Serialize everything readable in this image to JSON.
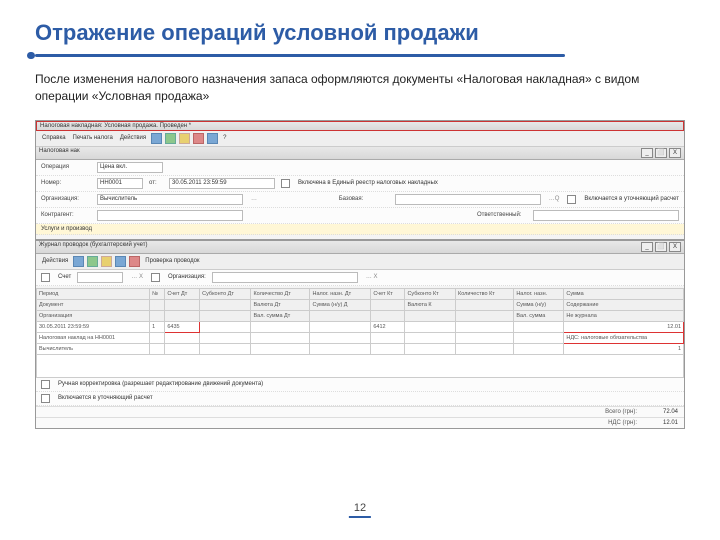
{
  "title": "Отражение операций условной продажи",
  "desc": "После изменения налогового назначения запаса оформляются документы «Налоговая накладная» с видом операции «Условная продажа»",
  "win1": {
    "title": "Налоговая накладная: Условная продажа. Проведен *",
    "btns": [
      "_",
      "⬜",
      "X"
    ]
  },
  "menu": [
    "Справка",
    "Печать налога",
    "Действия",
    "?"
  ],
  "row_op": {
    "lbl": "Операция",
    "val": "Ценa вкл."
  },
  "row_num": {
    "lbl": "Номер:",
    "val": "НН0001",
    "date_lbl": "от:",
    "date": "30.05.2011   23:59:59",
    "right1": "Включена в Единый реестр налоговых накладных",
    "right2": "Включается в уточняющий расчет"
  },
  "row_org": {
    "lbl": "Организация:",
    "val": "Вычислитель",
    "r_lbl": "Базовая:",
    "r_val": ""
  },
  "row_contr": {
    "lbl": "Контрагент:",
    "val": "",
    "r_lbl": "Ответственный:",
    "r_val": ""
  },
  "yellow": "Услуги и производ",
  "win2": {
    "title": "Журнал проводок (бухгалтерский учет)",
    "btns": [
      "_",
      "⬜",
      "X"
    ]
  },
  "tb2": [
    "Действия",
    "Проверка проводок"
  ],
  "filter": {
    "chk1": "Счет",
    "chk2": "Организация:"
  },
  "grid": {
    "h": [
      "Период",
      "№",
      "Счет Дт",
      "Субконто Дт",
      "Количество Дт",
      "Налог. назн. Дт",
      "Счет Кт",
      "Субконто Кт",
      "Количество Кт",
      "Налог. назн.",
      "Сумма"
    ],
    "h2": [
      "Документ",
      "",
      "",
      "",
      "Валюта Дт",
      "Сумма (н/у) Д",
      "",
      "Валюта К",
      "",
      "Сумма (н/у)",
      "Содержание"
    ],
    "h3": [
      "Организация",
      "",
      "",
      "",
      "Вал. сумма Дт",
      "",
      "",
      "",
      "",
      "Вал. сумма",
      "Не журнала"
    ],
    "r1": [
      "30.05.2011 23:59:59",
      "1",
      "6435",
      "",
      "",
      "",
      "6412",
      "",
      "",
      "",
      "12.01"
    ],
    "r2": [
      "Налоговая наклад на НН0001",
      "",
      "",
      "",
      "",
      "",
      "",
      "",
      "",
      "",
      "НДС: налоговые обязательства"
    ],
    "r3": [
      "Вычислитель",
      "",
      "",
      "",
      "",
      "",
      "",
      "",
      "",
      "",
      "1"
    ]
  },
  "chk_hand": "Ручная корректировка (разрешает редактирование движений документа)",
  "row_upd": "Включается в уточняющий расчет",
  "totals": [
    {
      "l": "Всего (грн):",
      "v": "72.04"
    },
    {
      "l": "НДС (грн):",
      "v": "12.01"
    }
  ],
  "page": "12"
}
